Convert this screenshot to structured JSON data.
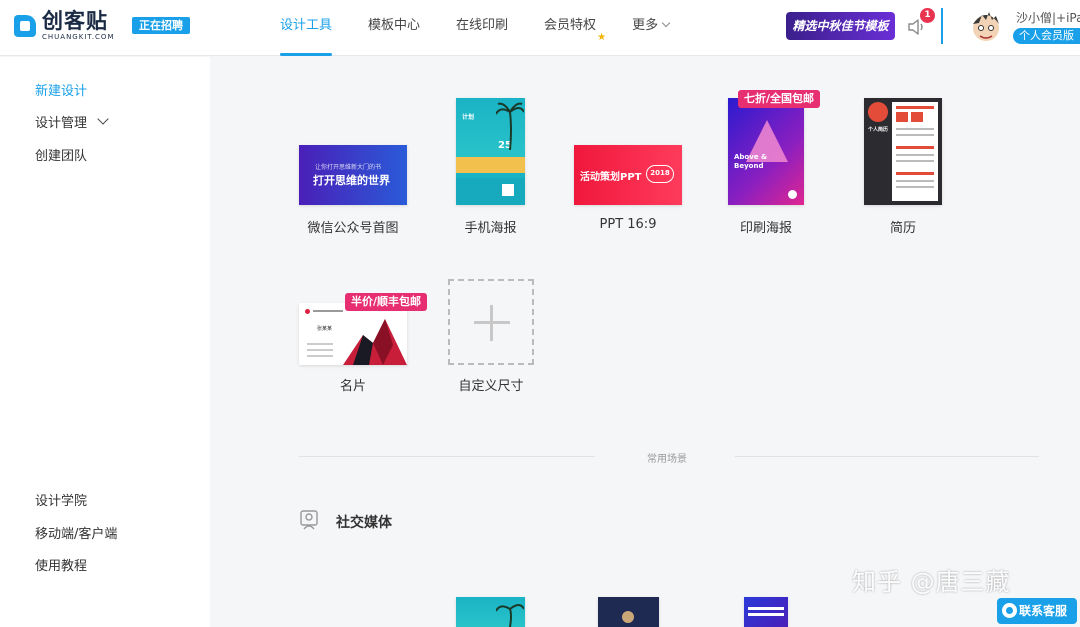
{
  "header": {
    "logo_cn": "创客贴",
    "logo_en": "CHUANGKIT.COM",
    "hiring": "正在招聘",
    "nav": [
      "设计工具",
      "模板中心",
      "在线印刷",
      "会员特权",
      "更多"
    ],
    "promo": "精选中秋佳节模板",
    "notification_count": "1",
    "username": "沙小僧|+iPa",
    "vip_label": "个人会员版"
  },
  "sidebar": {
    "top_items": [
      "新建设计",
      "设计管理",
      "创建团队"
    ],
    "bottom_items": [
      "设计学院",
      "移动端/客户端",
      "使用教程"
    ]
  },
  "templates": [
    {
      "label": "微信公众号首图",
      "thumb_title": "打开思维的世界",
      "thumb_sub": "让你打开思维新大门的书"
    },
    {
      "label": "手机海报",
      "thumb_title": "25",
      "thumb_sub": "计划"
    },
    {
      "label": "PPT 16:9",
      "thumb_title": "活动策划PPT",
      "thumb_sub": "2018"
    },
    {
      "label": "印刷海报",
      "tag": "七折/全国包邮",
      "thumb_title": "Above & Beyond"
    },
    {
      "label": "简历",
      "thumb_title": "个人简历"
    },
    {
      "label": "名片",
      "tag": "半价/顺丰包邮",
      "thumb_title": "张某某"
    },
    {
      "label": "自定义尺寸"
    }
  ],
  "scenes": {
    "divider": "常用场景",
    "section_title": "社交媒体"
  },
  "watermark": "知乎 @唐三藏",
  "contact": "联系客服",
  "colors": {
    "accent": "#1aa0e8",
    "tag": "#e62e71",
    "badge": "#e8344e"
  }
}
